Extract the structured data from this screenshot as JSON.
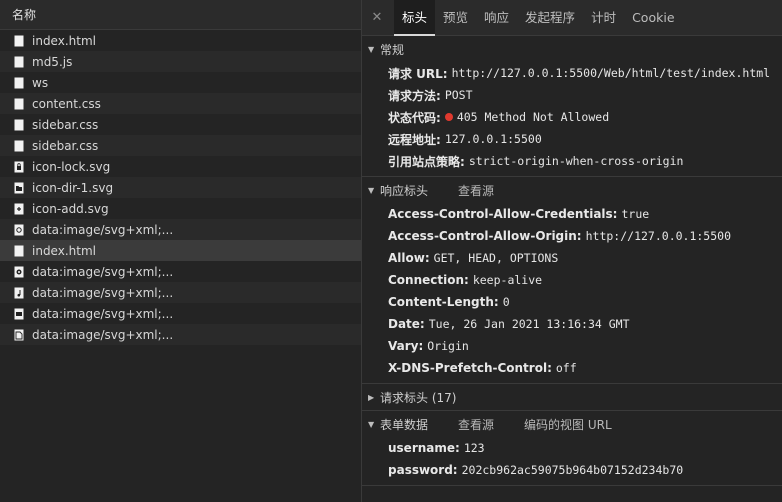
{
  "list": {
    "header": "名称",
    "items": [
      {
        "name": "index.html",
        "icon": "document-icon"
      },
      {
        "name": "md5.js",
        "icon": "document-icon"
      },
      {
        "name": "ws",
        "icon": "document-icon"
      },
      {
        "name": "content.css",
        "icon": "document-icon"
      },
      {
        "name": "sidebar.css",
        "icon": "document-icon"
      },
      {
        "name": "sidebar.css",
        "icon": "document-icon"
      },
      {
        "name": "icon-lock.svg",
        "icon": "lock-icon"
      },
      {
        "name": "icon-dir-1.svg",
        "icon": "folder-icon"
      },
      {
        "name": "icon-add.svg",
        "icon": "plus-icon"
      },
      {
        "name": "data:image/svg+xml;...",
        "icon": "svg-icon"
      },
      {
        "name": "index.html",
        "icon": "document-icon"
      },
      {
        "name": "data:image/svg+xml;...",
        "icon": "svg-icon"
      },
      {
        "name": "data:image/svg+xml;...",
        "icon": "music-icon"
      },
      {
        "name": "data:image/svg+xml;...",
        "icon": "image-icon"
      },
      {
        "name": "data:image/svg+xml;...",
        "icon": "file-icon"
      }
    ]
  },
  "tabs": [
    "标头",
    "预览",
    "响应",
    "发起程序",
    "计时",
    "Cookie"
  ],
  "general": {
    "title": "常规",
    "rows": [
      {
        "k": "请求 URL:",
        "v": "http://127.0.0.1:5500/Web/html/test/index.html"
      },
      {
        "k": "请求方法:",
        "v": "POST"
      },
      {
        "k": "状态代码:",
        "v": "405 Method Not Allowed"
      },
      {
        "k": "远程地址:",
        "v": "127.0.0.1:5500"
      },
      {
        "k": "引用站点策略:",
        "v": "strict-origin-when-cross-origin"
      }
    ]
  },
  "response": {
    "title": "响应标头",
    "link": "查看源",
    "rows": [
      {
        "k": "Access-Control-Allow-Credentials:",
        "v": "true"
      },
      {
        "k": "Access-Control-Allow-Origin:",
        "v": "http://127.0.0.1:5500"
      },
      {
        "k": "Allow:",
        "v": "GET, HEAD, OPTIONS"
      },
      {
        "k": "Connection:",
        "v": "keep-alive"
      },
      {
        "k": "Content-Length:",
        "v": "0"
      },
      {
        "k": "Date:",
        "v": "Tue, 26 Jan 2021 13:16:34 GMT"
      },
      {
        "k": "Vary:",
        "v": "Origin"
      },
      {
        "k": "X-DNS-Prefetch-Control:",
        "v": "off"
      }
    ]
  },
  "request": {
    "title": "请求标头 (17)"
  },
  "form": {
    "title": "表单数据",
    "link1": "查看源",
    "link2": "编码的视图 URL",
    "rows": [
      {
        "k": "username:",
        "v": "123"
      },
      {
        "k": "password:",
        "v": "202cb962ac59075b964b07152d234b70"
      }
    ]
  },
  "colors": {
    "status_dot": "#e0392e",
    "background": "#242424"
  }
}
